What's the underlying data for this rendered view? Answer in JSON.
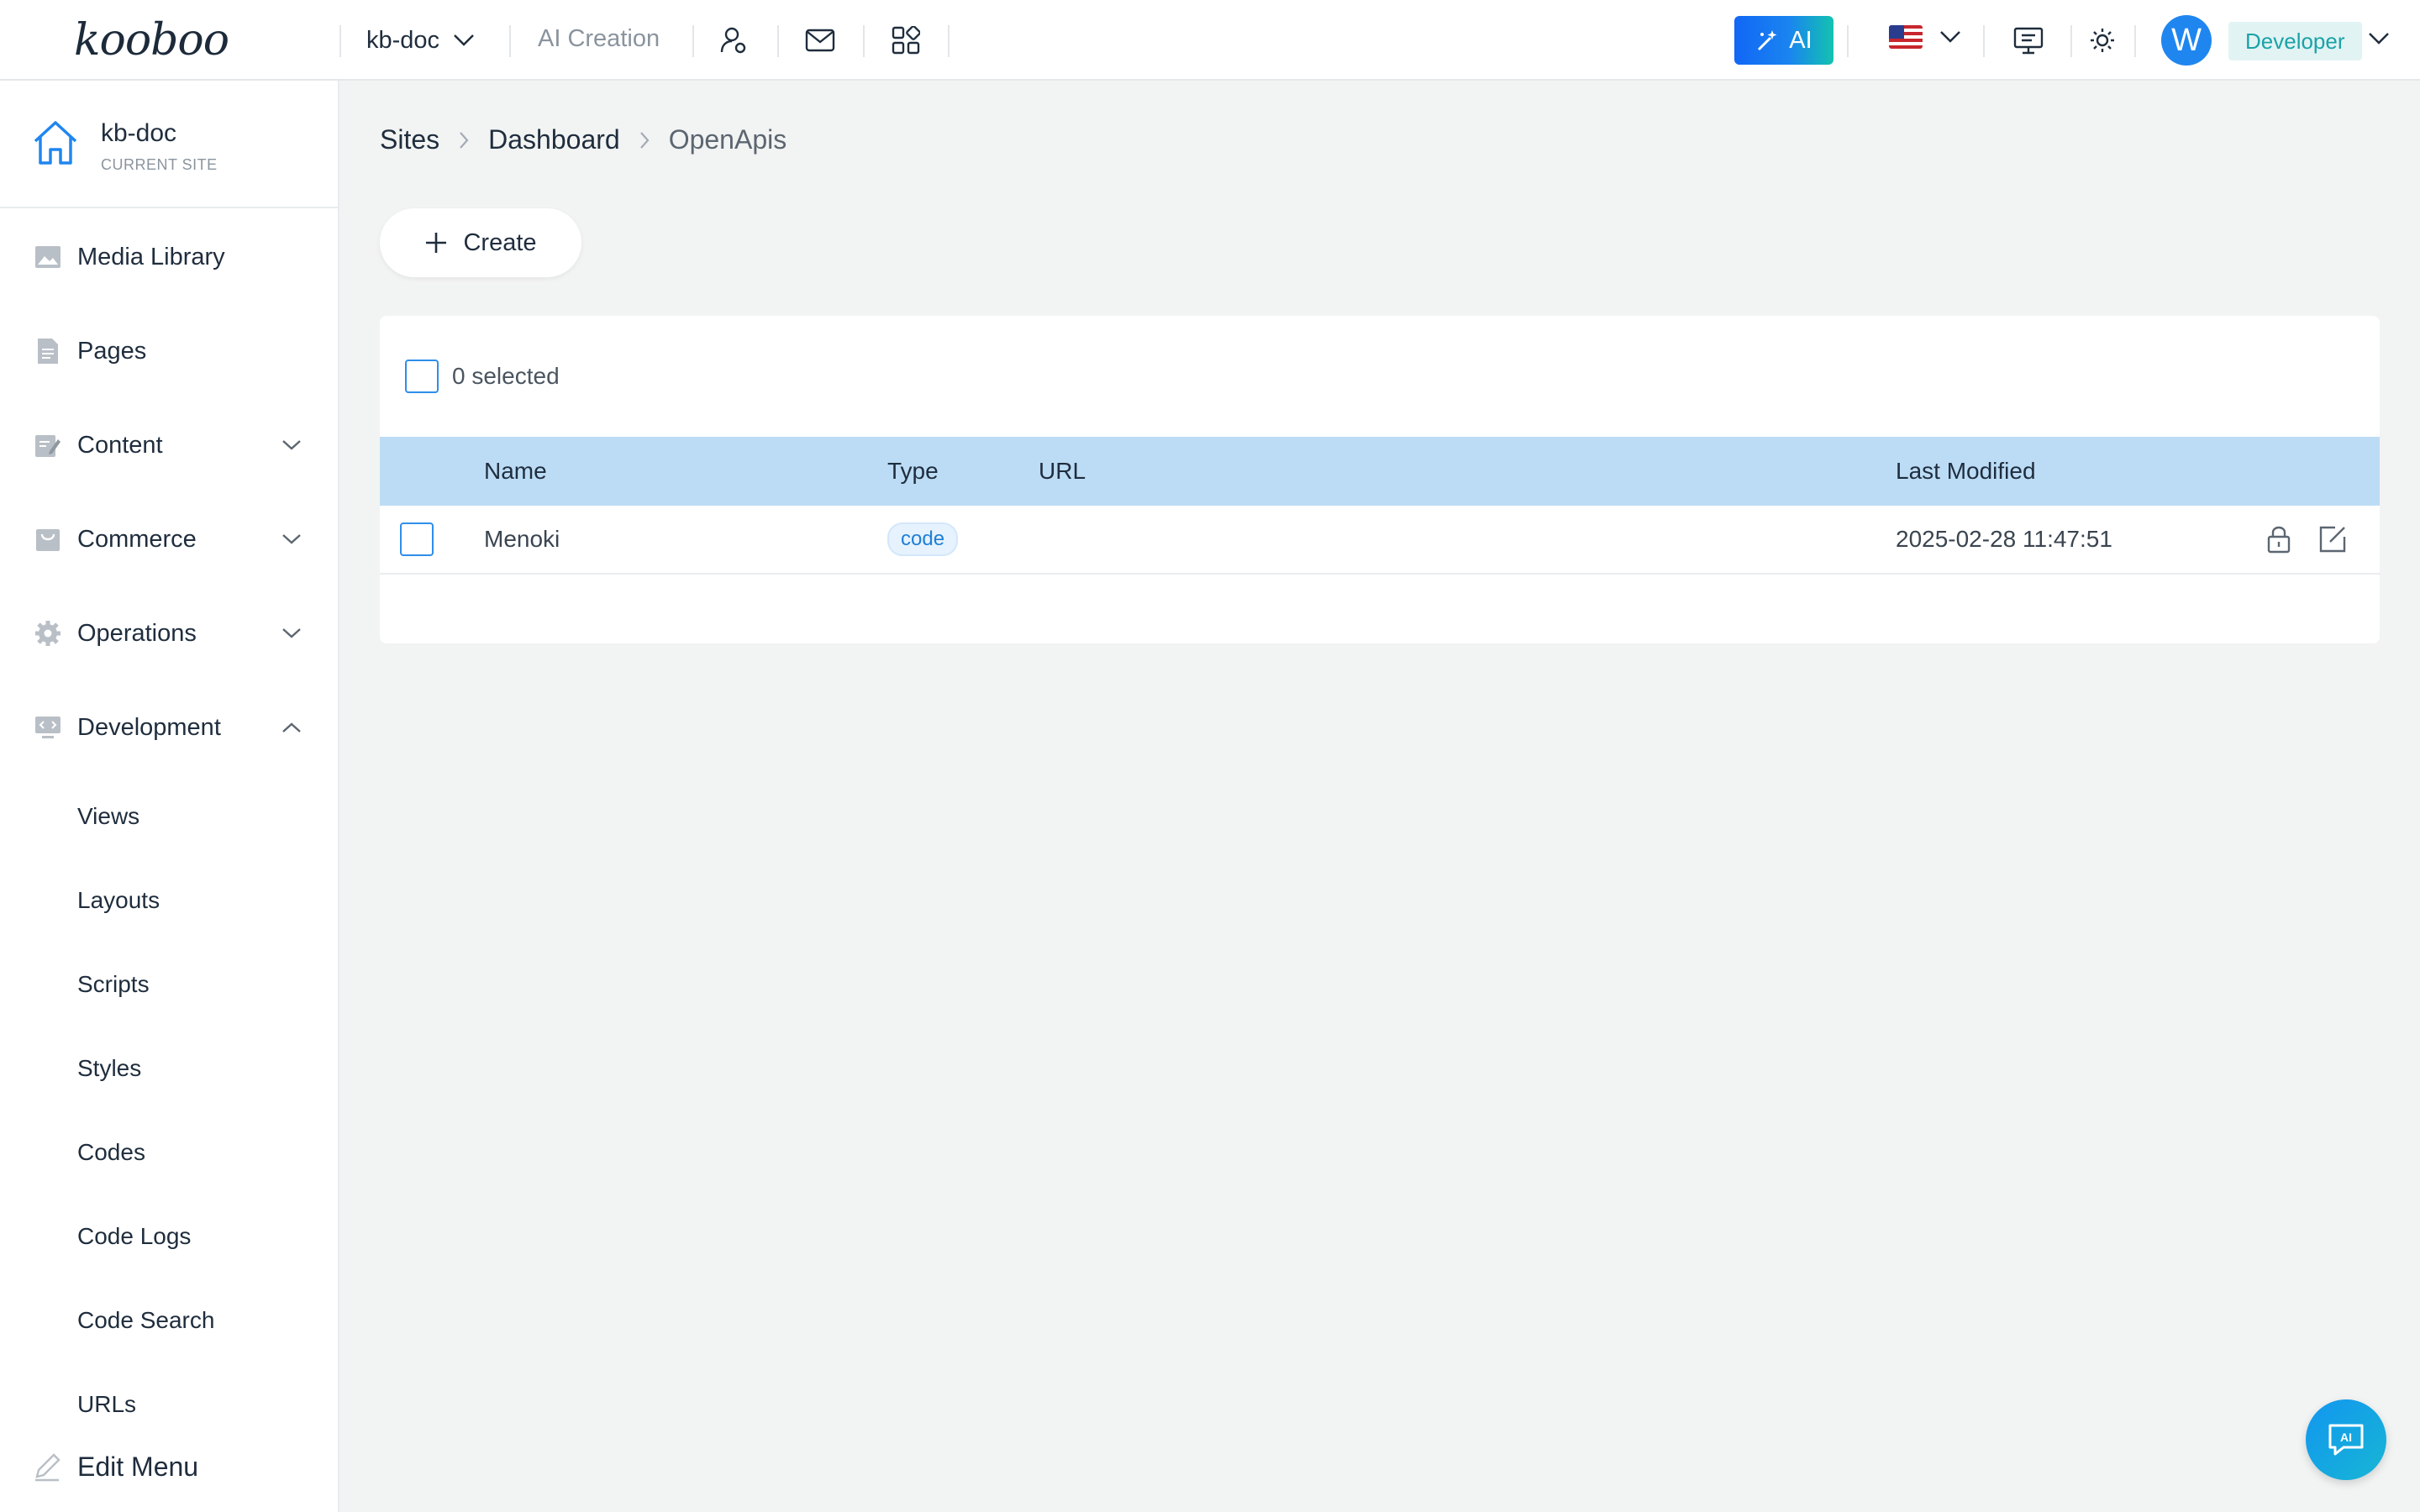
{
  "app": {
    "logo_text": "kooboo",
    "site_switcher_label": "kb-doc",
    "ai_creation": "AI Creation",
    "ai_button_label": "AI",
    "user_initial": "W",
    "role": "Developer"
  },
  "sidebar": {
    "current_site_name": "kb-doc",
    "current_site_caption": "CURRENT SITE",
    "items": [
      {
        "label": "Media Library"
      },
      {
        "label": "Pages"
      },
      {
        "label": "Content"
      },
      {
        "label": "Commerce"
      },
      {
        "label": "Operations"
      },
      {
        "label": "Development"
      }
    ],
    "development_sub": [
      {
        "label": "Views"
      },
      {
        "label": "Layouts"
      },
      {
        "label": "Scripts"
      },
      {
        "label": "Styles"
      },
      {
        "label": "Codes"
      },
      {
        "label": "Code Logs"
      },
      {
        "label": "Code Search"
      },
      {
        "label": "URLs"
      }
    ],
    "edit_menu": "Edit Menu"
  },
  "breadcrumb": [
    "Sites",
    "Dashboard",
    "OpenApis"
  ],
  "toolbar": {
    "create_label": "Create"
  },
  "table": {
    "selected_text": "0 selected",
    "columns": [
      "Name",
      "Type",
      "URL",
      "Last Modified"
    ],
    "rows": [
      {
        "name": "Menoki",
        "type": "code",
        "url": "",
        "last_modified": "2025-02-28 11:47:51"
      }
    ]
  },
  "colors": {
    "accent": "#1f86f0",
    "table_header": "#bcdcf6",
    "background": "#f2f3f3",
    "role_badge_bg": "#e2f3f4"
  },
  "float_button_label": "AI"
}
